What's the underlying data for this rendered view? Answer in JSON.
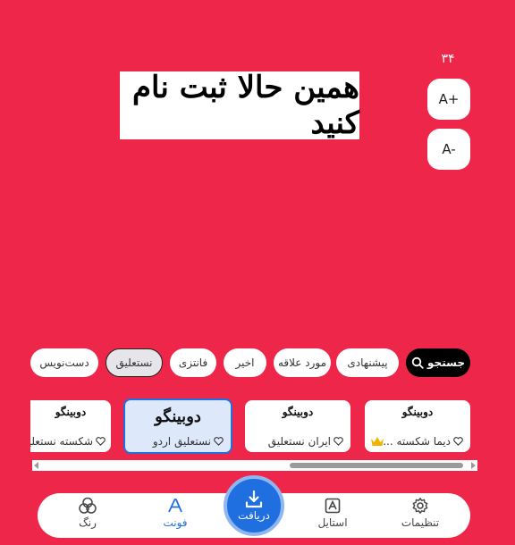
{
  "preview": {
    "text": "همین حالا ثبت نام کنید"
  },
  "size_controls": {
    "count": "۳۴",
    "increase_label": "A+",
    "decrease_label": "A-"
  },
  "filters": {
    "search_label": "جستجو",
    "chips": [
      "پیشنهادی",
      "مورد علاقه",
      "اخیر",
      "فانتزی",
      "نستعلیق",
      "دست‌نویس"
    ],
    "active": "نستعلیق"
  },
  "fonts": [
    {
      "sample": "دوبینگو",
      "name": "دیما شکسته ...",
      "premium": true
    },
    {
      "sample": "دوبینگو",
      "name": "ایران نستعلیق",
      "premium": false
    },
    {
      "sample": "دوبینگو",
      "name": "نستعلیق اردو",
      "premium": false,
      "selected": true
    },
    {
      "sample": "دوبینگو",
      "name": "شکسته نستعلیق",
      "premium": false
    }
  ],
  "nav": {
    "settings_label": "تنظیمات",
    "style_label": "استایل",
    "download_label": "دریافت",
    "font_label": "فونت",
    "color_label": "رنگ"
  },
  "colors": {
    "background": "#ee2649",
    "accent": "#1f6fe0",
    "selected_card": "#dde9fb"
  }
}
